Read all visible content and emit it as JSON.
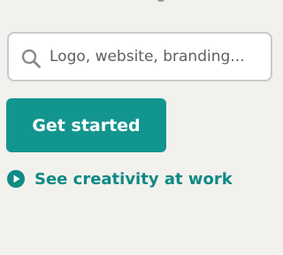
{
  "search": {
    "placeholder": "Logo, website, branding..."
  },
  "cta": {
    "label": "Get started"
  },
  "creativity_link": {
    "label": "See creativity at work"
  },
  "colors": {
    "background": "#f3f1ee",
    "accent": "#13958f",
    "link": "#0f8a84",
    "input_border": "#c9c9c9"
  },
  "icons": {
    "search": "search-icon",
    "play": "play-circle-icon"
  }
}
